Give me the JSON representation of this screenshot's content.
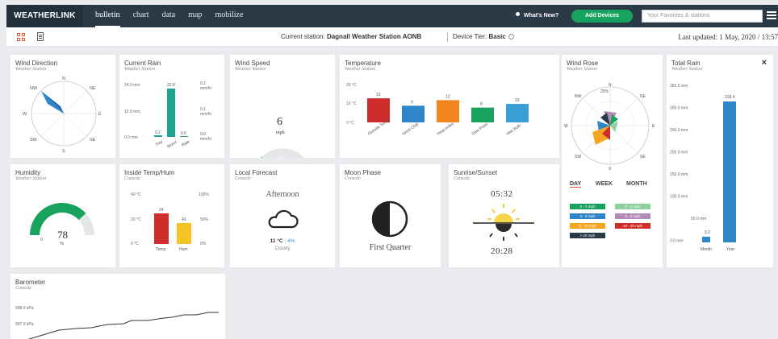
{
  "brand": "WEATHERLINK",
  "nav": [
    "bulletin",
    "chart",
    "data",
    "map",
    "mobilize"
  ],
  "header": {
    "whats_new": "What's New?",
    "add_devices": "Add Devices",
    "search_placeholder": "Your Favorites & stations"
  },
  "subheader": {
    "station_label": "Current station:",
    "station_name": "Dagnall Weather Station AONB",
    "tier_label": "Device Tier:",
    "tier_value": "Basic",
    "last_updated": "Last updated: 1 May, 2020 / 13:57"
  },
  "colors": {
    "accent": "#e2572b",
    "green": "#17a35e",
    "teal": "#1ba392",
    "red": "#cf2c2c",
    "yellow": "#f4c223",
    "blue": "#2e86c8",
    "nav": "#2b3a47"
  },
  "wind_direction": {
    "title": "Wind Direction",
    "subtitle": "Weather Station",
    "labels": {
      "n": "N",
      "ne": "NE",
      "e": "E",
      "se": "SE",
      "s": "S",
      "sw": "SW",
      "w": "W",
      "nw": "NW"
    }
  },
  "current_rain": {
    "title": "Current Rain",
    "subtitle": "Weather Station",
    "left_ticks": [
      "24.0 mm",
      "12.0 mm",
      "0.0 mm"
    ],
    "right_ticks": [
      "0.2",
      "mm/hr",
      "0.1",
      "mm/hr",
      "0.0",
      "mm/hr"
    ],
    "bars": [
      {
        "label": "Day",
        "value": "0.2"
      },
      {
        "label": "Storm",
        "value": "22.8"
      },
      {
        "label": "Rate",
        "value": "0.0"
      }
    ]
  },
  "wind_speed": {
    "title": "Wind Speed",
    "subtitle": "Weather Station",
    "value": "6",
    "unit": "mph",
    "min": "0"
  },
  "temperature": {
    "title": "Temperature",
    "subtitle": "Weather Station",
    "ticks": [
      "20 °C",
      "10 °C",
      "0 °C"
    ],
    "bars": [
      {
        "label": "Outside Temp",
        "value": "13",
        "color": "#cf2c2c"
      },
      {
        "label": "Wind Chill",
        "value": "9",
        "color": "#2e86c8"
      },
      {
        "label": "Heat Index",
        "value": "12",
        "color": "#f0861d"
      },
      {
        "label": "Dew Point",
        "value": "8",
        "color": "#17a35e"
      },
      {
        "label": "Wet Bulb",
        "value": "10",
        "color": "#3a9fd6"
      }
    ]
  },
  "wind_rose": {
    "title": "Wind Rose",
    "subtitle": "Weather Station",
    "center_label": "25%",
    "labels": {
      "n": "N",
      "ne": "NE",
      "e": "E",
      "se": "SE",
      "s": "S",
      "sw": "SW",
      "w": "W",
      "nw": "NW"
    },
    "periods": [
      "DAY",
      "WEEK",
      "MONTH"
    ],
    "ranges": [
      {
        "label": "0 - 2 mph",
        "color": "#17a35e"
      },
      {
        "label": "2 - 4 mph",
        "color": "#8fcf9f"
      },
      {
        "label": "4 - 6 mph",
        "color": "#2e86c8"
      },
      {
        "label": "6 - 8 mph",
        "color": "#b58ab8"
      },
      {
        "label": "8 - 10 mph",
        "color": "#f4a623"
      },
      {
        "label": "10 - 20 mph",
        "color": "#cf2c2c"
      },
      {
        "label": "> 20 mph",
        "color": "#2b3a47"
      }
    ]
  },
  "total_rain": {
    "title": "Total Rain",
    "subtitle": "Weather Station",
    "ticks": [
      "350.0 mm",
      "300.0 mm",
      "250.0 mm",
      "200.0 mm",
      "150.0 mm",
      "100.0 mm",
      "50.0 mm",
      "0.0 mm"
    ],
    "bars": [
      {
        "label": "Month",
        "value": "9.2"
      },
      {
        "label": "Year",
        "value": "318.4"
      }
    ]
  },
  "humidity": {
    "title": "Humidity",
    "subtitle": "Weather Station",
    "value": "78",
    "unit": "%",
    "min": "0"
  },
  "inside": {
    "title": "Inside Temp/Hum",
    "subtitle": "Console",
    "left_ticks": [
      "40 °C",
      "20 °C",
      "0 °C"
    ],
    "right_ticks": [
      "100%",
      "50%",
      "0%"
    ],
    "bars": [
      {
        "label": "Temp",
        "value": "24"
      },
      {
        "label": "Hum",
        "value": "42"
      }
    ]
  },
  "forecast": {
    "title": "Local Forecast",
    "subtitle": "Console",
    "period": "Afternoon",
    "temp": "11 °C",
    "precip": "4%",
    "condition": "Cloudy"
  },
  "moon": {
    "title": "Moon Phase",
    "subtitle": "Console",
    "phase": "First Quarter"
  },
  "sun": {
    "title": "Sunrise/Sunset",
    "subtitle": "Console",
    "sunrise": "05:32",
    "sunset": "20:28"
  },
  "barometer": {
    "title": "Barometer",
    "subtitle": "Console",
    "ticks": [
      "998.0 kPa",
      "997.0 kPa"
    ]
  }
}
